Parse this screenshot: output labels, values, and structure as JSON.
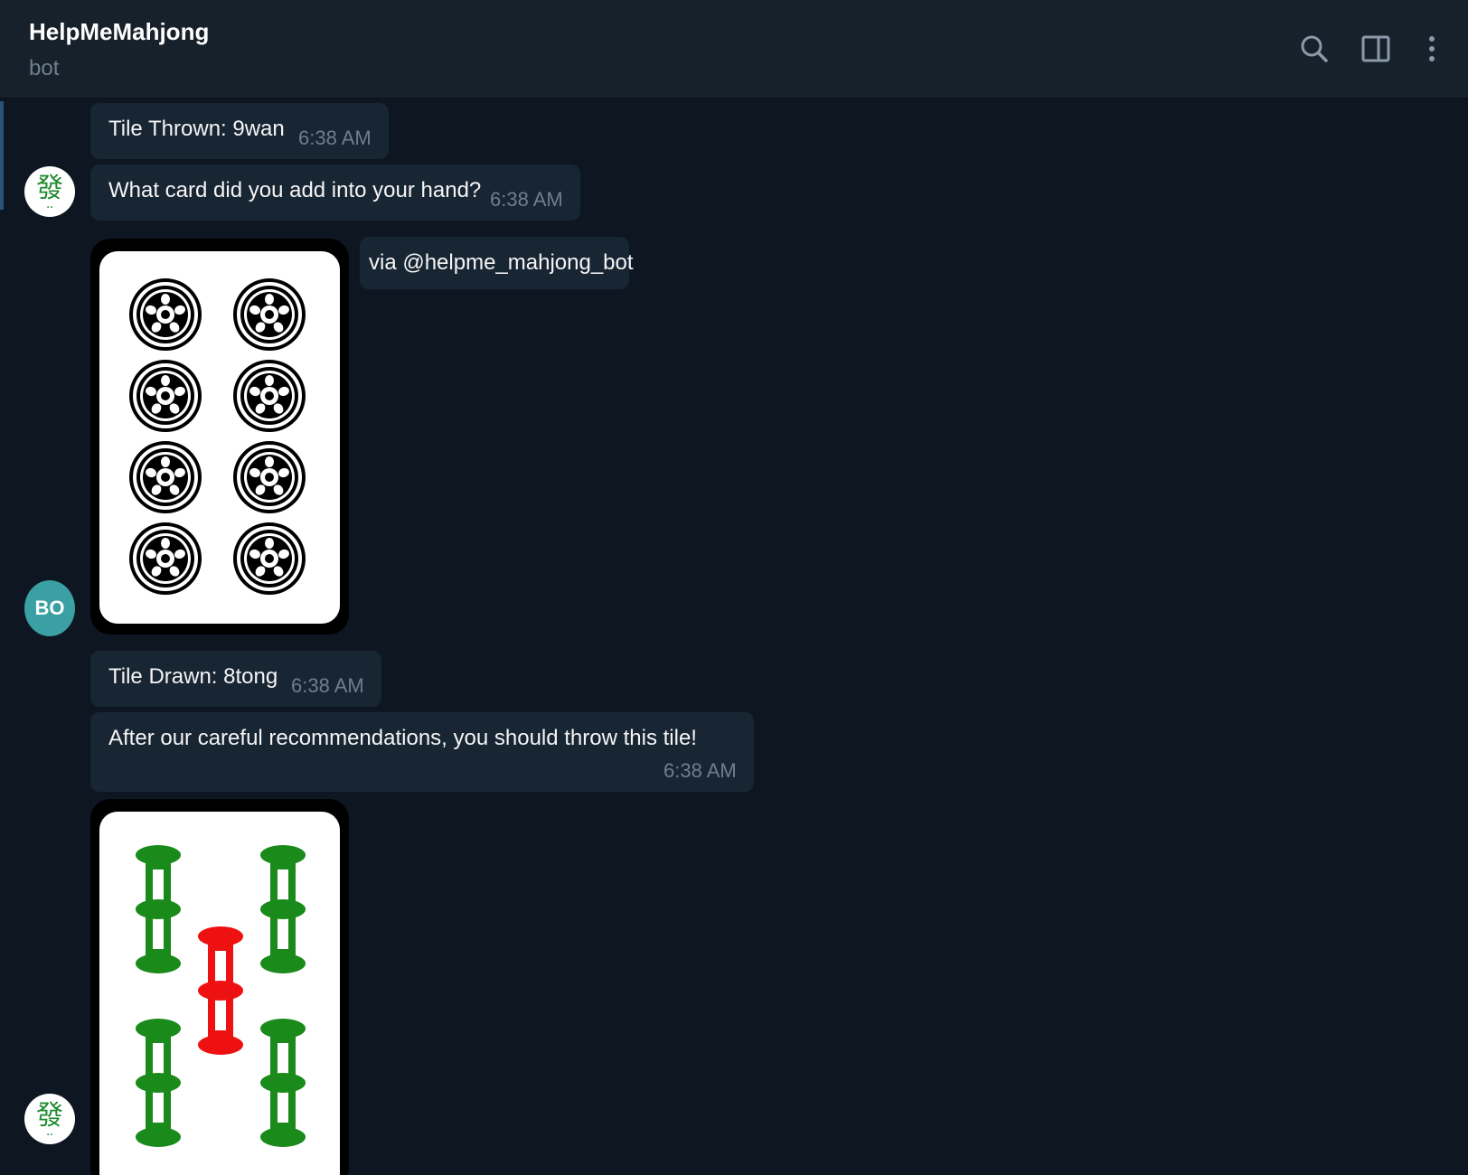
{
  "header": {
    "title": "HelpMeMahjong",
    "subtitle": "bot",
    "icons": [
      "search-icon",
      "sidebar-toggle-icon",
      "more-vertical-icon"
    ]
  },
  "messages": {
    "tile_thrown": {
      "text": "Tile Thrown: 9wan",
      "time": "6:38 AM"
    },
    "question": {
      "text": "What card did you add into your hand?",
      "time": "6:38 AM"
    },
    "via": {
      "text": "via @helpme_mahjong_bot"
    },
    "tile_drawn": {
      "text": "Tile Drawn: 8tong",
      "time": "6:38 AM"
    },
    "recommendation": {
      "text": "After our careful recommendations, you should throw this tile!",
      "time": "6:38 AM"
    }
  },
  "avatars": {
    "bot_glyph": "發",
    "user_initials": "BO"
  },
  "tiles": {
    "first": "8tong",
    "second": "5tiao"
  },
  "colors": {
    "background": "#0e1621",
    "header": "#17212b",
    "bubble": "#182533",
    "time_text": "#6d7f8f",
    "user_avatar": "#3aa0a3",
    "bamboo_green": "#1a8a1a",
    "bamboo_red": "#ee1111"
  }
}
